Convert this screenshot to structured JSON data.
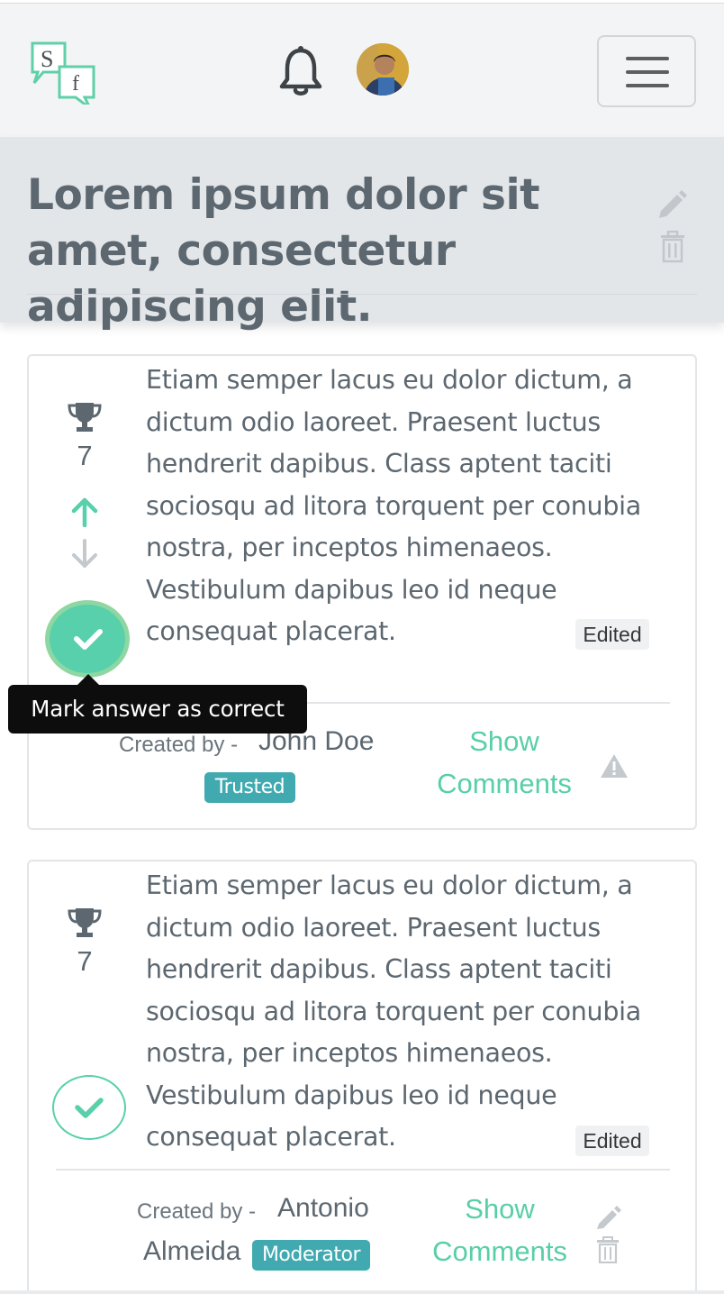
{
  "navbar": {
    "logo_letters": [
      "S",
      "f"
    ],
    "bell_icon": "bell-icon",
    "avatar_icon": "user-avatar",
    "menu_icon": "hamburger-menu-icon"
  },
  "question": {
    "title": "Lorem ipsum dolor sit amet, consectetur adipiscing elit.",
    "edit_icon": "pencil-icon",
    "delete_icon": "trash-icon"
  },
  "answers": [
    {
      "votes": "7",
      "text": "Etiam semper lacus eu dolor dictum, a dictum odio laoreet. Praesent luctus hendrerit dapibus. Class aptent taciti sociosqu ad litora torquent per conubia nostra, per inceptos himenaeos. Vestibulum dapibus leo id neque consequat placerat.",
      "edited_label": "Edited",
      "created_by_label": "Created by -",
      "author": "John Doe",
      "badge": "Trusted",
      "show_comments": "Show Comments",
      "tooltip": "Mark answer as correct"
    },
    {
      "votes": "7",
      "text": "Etiam semper lacus eu dolor dictum, a dictum odio laoreet. Praesent luctus hendrerit dapibus. Class aptent taciti sociosqu ad litora torquent per conubia nostra, per inceptos himenaeos. Vestibulum dapibus leo id neque consequat placerat.",
      "edited_label": "Edited",
      "created_by_label": "Created by -",
      "author_line1": "Antonio",
      "author_line2": "Almeida",
      "badge": "Moderator",
      "show_comments": "Show Comments"
    }
  ],
  "colors": {
    "accent_green": "#57d0ab",
    "badge_teal": "#41aab0",
    "text_gray": "#5c6770",
    "header_bg": "#e3e6e9"
  }
}
